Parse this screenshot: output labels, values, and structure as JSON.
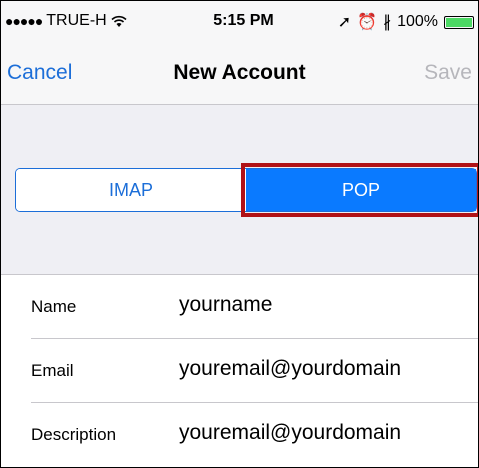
{
  "status_bar": {
    "signal": "●●●●●",
    "carrier": "TRUE-H",
    "time": "5:15 PM",
    "location_glyph": "➚",
    "alarm_glyph": "⏰",
    "bluetooth_glyph": "∦",
    "battery": "100%"
  },
  "nav": {
    "cancel": "Cancel",
    "title": "New Account",
    "save": "Save"
  },
  "segment": {
    "options": [
      "IMAP",
      "POP"
    ],
    "selected": "POP"
  },
  "form": {
    "rows": [
      {
        "label": "Name",
        "value": "yourname"
      },
      {
        "label": "Email",
        "value": "youremail@yourdomain"
      },
      {
        "label": "Description",
        "value": "youremail@yourdomain"
      }
    ]
  },
  "colors": {
    "accent": "#1c6ed8",
    "selected_fill": "#0a7aff",
    "highlight": "#b01217",
    "battery": "#4cd964"
  }
}
